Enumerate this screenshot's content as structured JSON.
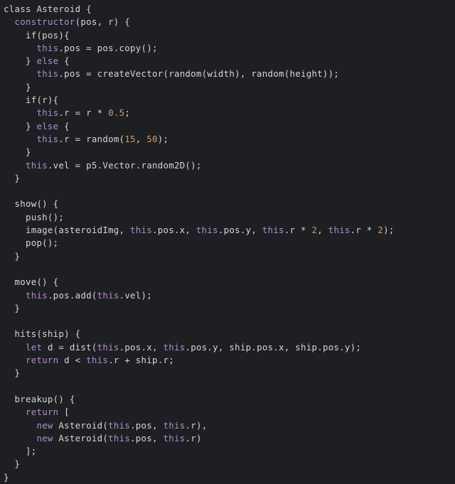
{
  "editor": {
    "name": "code-editor",
    "language": "javascript",
    "background_color": "#1e1f22",
    "default_text_color": "#d6d6d6",
    "keyword_color": "#b58bd0",
    "number_color": "#cf9b6b",
    "font_size_px": 12.4,
    "line_height_px": 18.3,
    "filename_inferred": "asteroid.js"
  },
  "code": {
    "lines": [
      {
        "n": 1,
        "tokens": [
          {
            "t": "class",
            "c": "default"
          },
          {
            "t": " ",
            "c": "default"
          },
          {
            "t": "Asteroid",
            "c": "class"
          },
          {
            "t": " {",
            "c": "punct"
          }
        ]
      },
      {
        "n": 2,
        "tokens": [
          {
            "t": "  ",
            "c": "default"
          },
          {
            "t": "constructor",
            "c": "keyword"
          },
          {
            "t": "(pos, r) {",
            "c": "punct"
          }
        ]
      },
      {
        "n": 3,
        "tokens": [
          {
            "t": "    if(pos){",
            "c": "default"
          }
        ]
      },
      {
        "n": 4,
        "tokens": [
          {
            "t": "      ",
            "c": "default"
          },
          {
            "t": "this",
            "c": "this"
          },
          {
            "t": ".pos = pos.copy();",
            "c": "default"
          }
        ]
      },
      {
        "n": 5,
        "tokens": [
          {
            "t": "    } ",
            "c": "default"
          },
          {
            "t": "else",
            "c": "keyword"
          },
          {
            "t": " {",
            "c": "default"
          }
        ]
      },
      {
        "n": 6,
        "tokens": [
          {
            "t": "      ",
            "c": "default"
          },
          {
            "t": "this",
            "c": "this"
          },
          {
            "t": ".pos = createVector(random(width), random(height));",
            "c": "default"
          }
        ]
      },
      {
        "n": 7,
        "tokens": [
          {
            "t": "    }",
            "c": "default"
          }
        ]
      },
      {
        "n": 8,
        "tokens": [
          {
            "t": "    if(r){",
            "c": "default"
          }
        ]
      },
      {
        "n": 9,
        "tokens": [
          {
            "t": "      ",
            "c": "default"
          },
          {
            "t": "this",
            "c": "this"
          },
          {
            "t": ".r = r * ",
            "c": "default"
          },
          {
            "t": "0.5",
            "c": "number"
          },
          {
            "t": ";",
            "c": "default"
          }
        ]
      },
      {
        "n": 10,
        "tokens": [
          {
            "t": "    } ",
            "c": "default"
          },
          {
            "t": "else",
            "c": "keyword"
          },
          {
            "t": " {",
            "c": "default"
          }
        ]
      },
      {
        "n": 11,
        "tokens": [
          {
            "t": "      ",
            "c": "default"
          },
          {
            "t": "this",
            "c": "this"
          },
          {
            "t": ".r = random(",
            "c": "default"
          },
          {
            "t": "15",
            "c": "number"
          },
          {
            "t": ", ",
            "c": "default"
          },
          {
            "t": "50",
            "c": "number"
          },
          {
            "t": ");",
            "c": "default"
          }
        ]
      },
      {
        "n": 12,
        "tokens": [
          {
            "t": "    }",
            "c": "default"
          }
        ]
      },
      {
        "n": 13,
        "tokens": [
          {
            "t": "    ",
            "c": "default"
          },
          {
            "t": "this",
            "c": "this"
          },
          {
            "t": ".vel = p5.Vector.random2D();",
            "c": "default"
          }
        ]
      },
      {
        "n": 14,
        "tokens": [
          {
            "t": "  }",
            "c": "default"
          }
        ]
      },
      {
        "n": 15,
        "tokens": [
          {
            "t": " ",
            "c": "blank"
          }
        ]
      },
      {
        "n": 16,
        "tokens": [
          {
            "t": "  show() {",
            "c": "default"
          }
        ]
      },
      {
        "n": 17,
        "tokens": [
          {
            "t": "    push();",
            "c": "default"
          }
        ]
      },
      {
        "n": 18,
        "tokens": [
          {
            "t": "    image(asteroidImg, ",
            "c": "default"
          },
          {
            "t": "this",
            "c": "this"
          },
          {
            "t": ".pos.x, ",
            "c": "default"
          },
          {
            "t": "this",
            "c": "this"
          },
          {
            "t": ".pos.y, ",
            "c": "default"
          },
          {
            "t": "this",
            "c": "this"
          },
          {
            "t": ".r * ",
            "c": "default"
          },
          {
            "t": "2",
            "c": "number"
          },
          {
            "t": ", ",
            "c": "default"
          },
          {
            "t": "this",
            "c": "this"
          },
          {
            "t": ".r * ",
            "c": "default"
          },
          {
            "t": "2",
            "c": "number"
          },
          {
            "t": ");",
            "c": "default"
          }
        ]
      },
      {
        "n": 19,
        "tokens": [
          {
            "t": "    pop();",
            "c": "default"
          }
        ]
      },
      {
        "n": 20,
        "tokens": [
          {
            "t": "  }",
            "c": "default"
          }
        ]
      },
      {
        "n": 21,
        "tokens": [
          {
            "t": " ",
            "c": "blank"
          }
        ]
      },
      {
        "n": 22,
        "tokens": [
          {
            "t": "  move() {",
            "c": "default"
          }
        ]
      },
      {
        "n": 23,
        "tokens": [
          {
            "t": "    ",
            "c": "default"
          },
          {
            "t": "this",
            "c": "this"
          },
          {
            "t": ".pos.add(",
            "c": "default"
          },
          {
            "t": "this",
            "c": "this"
          },
          {
            "t": ".vel);",
            "c": "default"
          }
        ]
      },
      {
        "n": 24,
        "tokens": [
          {
            "t": "  }",
            "c": "default"
          }
        ]
      },
      {
        "n": 25,
        "tokens": [
          {
            "t": " ",
            "c": "blank"
          }
        ]
      },
      {
        "n": 26,
        "tokens": [
          {
            "t": "  hits(ship) {",
            "c": "default"
          }
        ]
      },
      {
        "n": 27,
        "tokens": [
          {
            "t": "    ",
            "c": "default"
          },
          {
            "t": "let",
            "c": "keyword"
          },
          {
            "t": " d = dist(",
            "c": "default"
          },
          {
            "t": "this",
            "c": "this"
          },
          {
            "t": ".pos.x, ",
            "c": "default"
          },
          {
            "t": "this",
            "c": "this"
          },
          {
            "t": ".pos.y, ship.pos.x, ship.pos.y);",
            "c": "default"
          }
        ]
      },
      {
        "n": 28,
        "tokens": [
          {
            "t": "    ",
            "c": "default"
          },
          {
            "t": "return",
            "c": "keyword"
          },
          {
            "t": " d < ",
            "c": "default"
          },
          {
            "t": "this",
            "c": "this"
          },
          {
            "t": ".r + ship.r;",
            "c": "default"
          }
        ]
      },
      {
        "n": 29,
        "tokens": [
          {
            "t": "  }",
            "c": "default"
          }
        ]
      },
      {
        "n": 30,
        "tokens": [
          {
            "t": " ",
            "c": "blank"
          }
        ]
      },
      {
        "n": 31,
        "tokens": [
          {
            "t": "  breakup() {",
            "c": "default"
          }
        ]
      },
      {
        "n": 32,
        "tokens": [
          {
            "t": "    ",
            "c": "default"
          },
          {
            "t": "return",
            "c": "keyword"
          },
          {
            "t": " [",
            "c": "default"
          }
        ]
      },
      {
        "n": 33,
        "tokens": [
          {
            "t": "      ",
            "c": "default"
          },
          {
            "t": "new",
            "c": "keyword"
          },
          {
            "t": " Asteroid(",
            "c": "default"
          },
          {
            "t": "this",
            "c": "this"
          },
          {
            "t": ".pos, ",
            "c": "default"
          },
          {
            "t": "this",
            "c": "this"
          },
          {
            "t": ".r),",
            "c": "default"
          }
        ]
      },
      {
        "n": 34,
        "tokens": [
          {
            "t": "      ",
            "c": "default"
          },
          {
            "t": "new",
            "c": "keyword"
          },
          {
            "t": " Asteroid(",
            "c": "default"
          },
          {
            "t": "this",
            "c": "this"
          },
          {
            "t": ".pos, ",
            "c": "default"
          },
          {
            "t": "this",
            "c": "this"
          },
          {
            "t": ".r)",
            "c": "default"
          }
        ]
      },
      {
        "n": 35,
        "tokens": [
          {
            "t": "    ];",
            "c": "default"
          }
        ]
      },
      {
        "n": 36,
        "tokens": [
          {
            "t": "  }",
            "c": "default"
          }
        ]
      },
      {
        "n": 37,
        "tokens": [
          {
            "t": "}",
            "c": "default"
          }
        ]
      }
    ]
  }
}
